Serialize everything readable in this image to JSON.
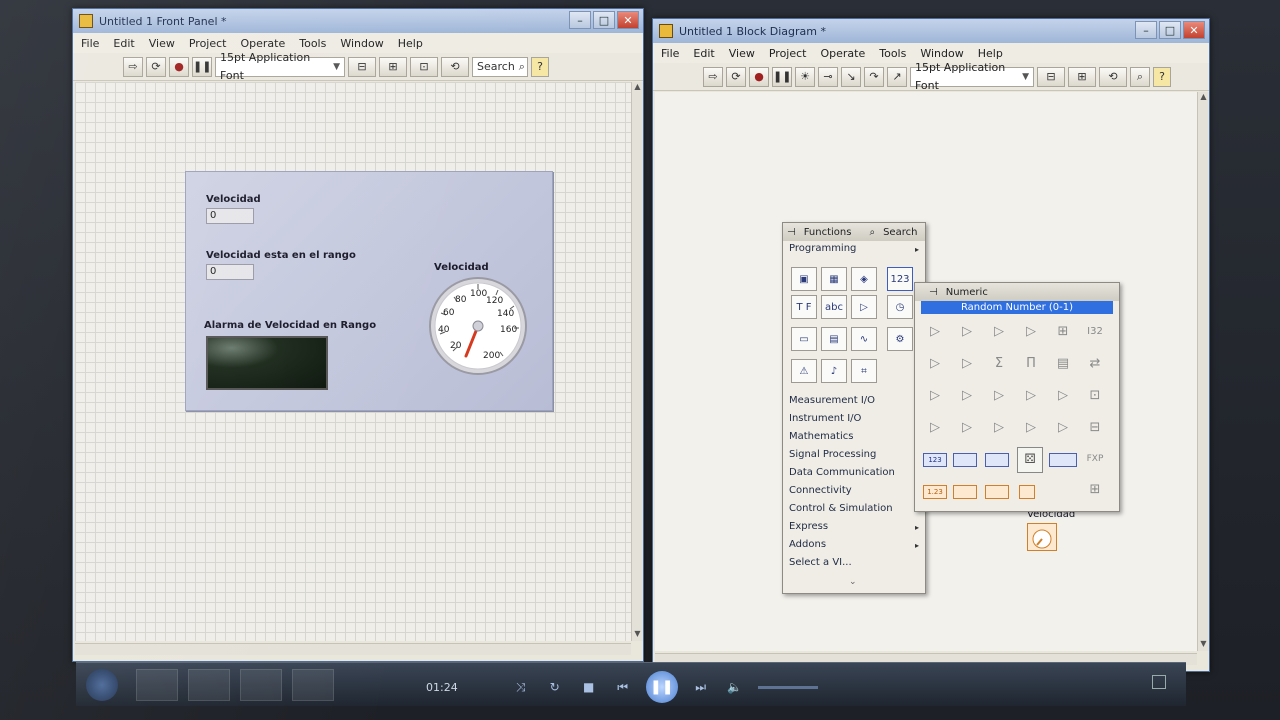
{
  "front_panel": {
    "title": "Untitled 1 Front Panel *",
    "menu": [
      "File",
      "Edit",
      "View",
      "Project",
      "Operate",
      "Tools",
      "Window",
      "Help"
    ],
    "font": "15pt Application Font",
    "search": "Search",
    "controls": {
      "velocidad_label": "Velocidad",
      "velocidad_value": "0",
      "rango_label": "Velocidad esta en el rango",
      "rango_value": "0",
      "alarma_label": "Alarma de Velocidad en Rango",
      "gauge_label": "Velocidad",
      "gauge_ticks": [
        "20",
        "40",
        "60",
        "80",
        "100",
        "120",
        "140",
        "160",
        "200"
      ]
    }
  },
  "block_diagram": {
    "title": "Untitled 1 Block Diagram *",
    "menu": [
      "File",
      "Edit",
      "View",
      "Project",
      "Operate",
      "Tools",
      "Window",
      "Help"
    ],
    "font": "15pt Application Font",
    "gauge_terminal_label": "Velocidad"
  },
  "functions_palette": {
    "title": "Functions",
    "search": "Search",
    "category": "Programming",
    "items": [
      "Measurement I/O",
      "Instrument I/O",
      "Mathematics",
      "Signal Processing",
      "Data Communication",
      "Connectivity",
      "Control & Simulation",
      "Express",
      "Addons",
      "Select a VI..."
    ]
  },
  "numeric_palette": {
    "title": "Numeric",
    "highlight": "Random Number (0-1)",
    "constants": [
      "123",
      "1.23"
    ]
  },
  "taskbar": {
    "time": "01:24"
  }
}
